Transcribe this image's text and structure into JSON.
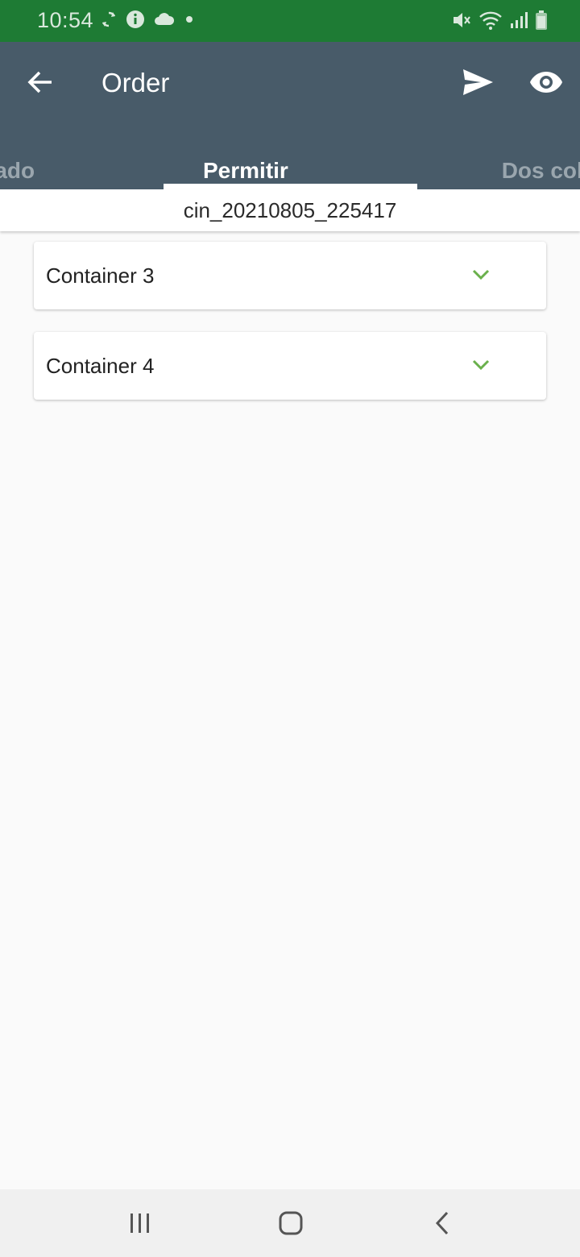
{
  "status_bar": {
    "time": "10:54",
    "left_icons": [
      "sync-icon",
      "info-icon",
      "cloud-icon",
      "dot-icon"
    ],
    "right_icons": [
      "mute-icon",
      "wifi-icon",
      "signal-icon",
      "battery-icon"
    ]
  },
  "app_bar": {
    "title": "Order",
    "actions": [
      "send-icon",
      "eye-icon"
    ],
    "background": "#485b69"
  },
  "tabs": {
    "left_label": "Colapsado\nDefault",
    "active_label": "Permitir\ncolapsar",
    "right_label": "Dos columnas\nrenglon"
  },
  "subheader": {
    "text": "cin_20210805_225417"
  },
  "containers": [
    {
      "label": "Container 3"
    },
    {
      "label": "Container 4"
    }
  ],
  "colors": {
    "status_bar": "#1e7b34",
    "accent_green": "#6ab04c"
  }
}
